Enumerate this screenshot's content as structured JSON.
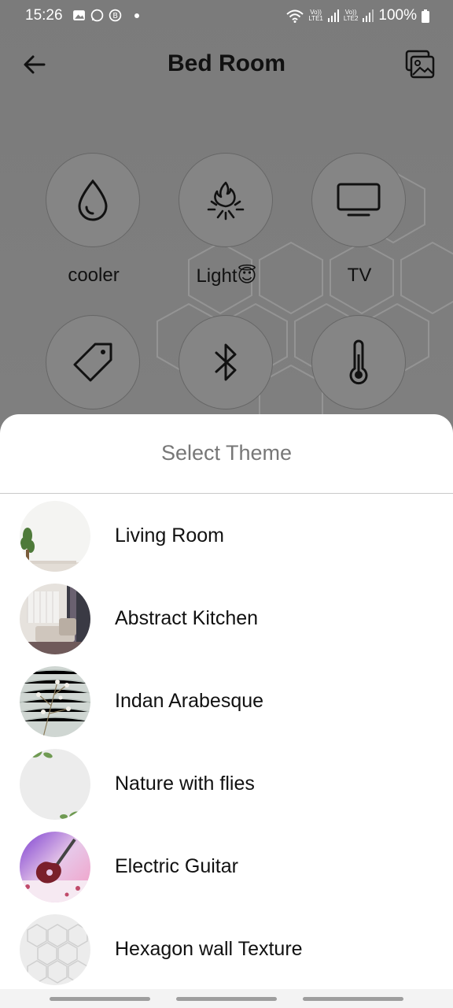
{
  "status_bar": {
    "time": "15:26",
    "battery": "100%",
    "sim1": "LTE1",
    "sim2": "LTE2",
    "volte1": "Vo))",
    "volte2": "Vo))"
  },
  "app_bar": {
    "title": "Bed Room",
    "back_icon": "arrow-left-icon",
    "theme_icon": "images-icon"
  },
  "devices": [
    {
      "label": "cooler",
      "icon": "water-drop-icon"
    },
    {
      "label": "Light",
      "icon": "campfire-icon",
      "emoji": "😇"
    },
    {
      "label": "TV",
      "icon": "tv-icon"
    },
    {
      "label": "",
      "icon": "tag-icon"
    },
    {
      "label": "",
      "icon": "bluetooth-icon"
    },
    {
      "label": "",
      "icon": "thermometer-icon"
    }
  ],
  "sheet": {
    "title": "Select Theme",
    "themes": [
      {
        "name": "Living Room"
      },
      {
        "name": "Abstract Kitchen"
      },
      {
        "name": "Indan Arabesque"
      },
      {
        "name": "Nature with flies"
      },
      {
        "name": "Electric Guitar"
      },
      {
        "name": "Hexagon wall Texture"
      }
    ]
  },
  "colors": {
    "overlay_bg": "#7d7d7d",
    "sheet_bg": "#ffffff",
    "title_text": "#111111",
    "sheet_title_text": "#777777"
  }
}
